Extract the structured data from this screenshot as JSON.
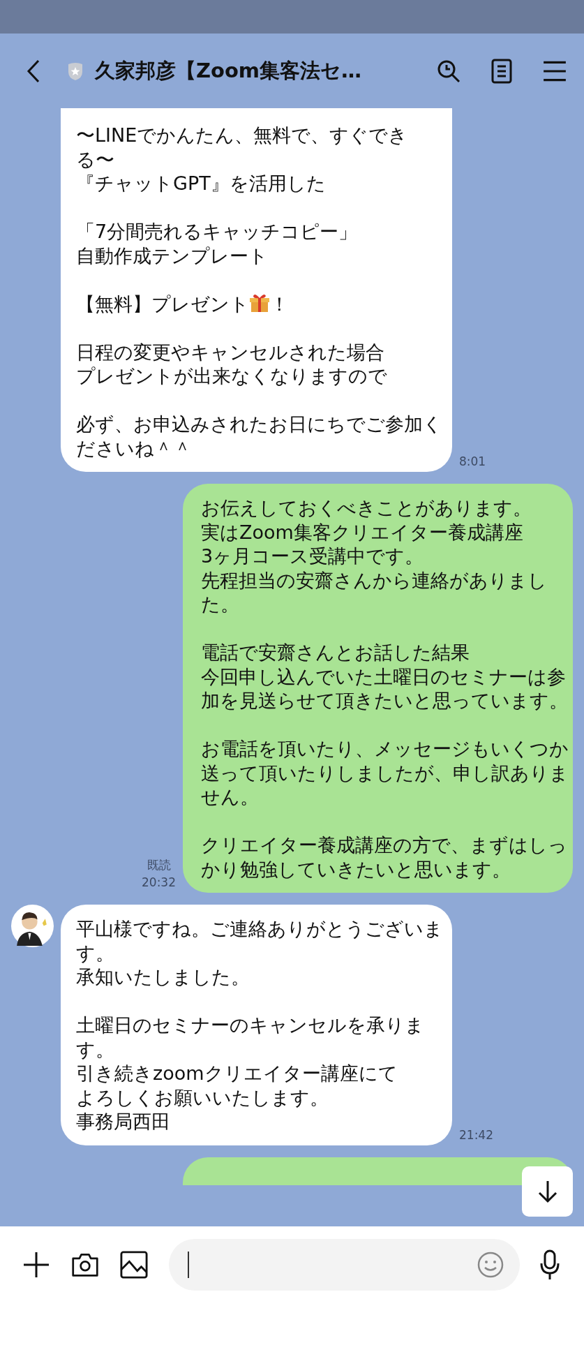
{
  "header": {
    "title": "久家邦彦【Zoom集客法セ…"
  },
  "messages": [
    {
      "kind": "incoming",
      "avatar": false,
      "cut_top": true,
      "time": "8:01",
      "paragraphs": [
        {
          "kind": "text",
          "lines": [
            "〜LINEでかんたん、無料で、すぐできる〜",
            "『チャットGPT』を活用した"
          ]
        },
        {
          "kind": "text",
          "lines": [
            "「7分間売れるキャッチコピー」",
            "自動作成テンプレート"
          ]
        },
        {
          "kind": "gift",
          "before": "【無料】プレゼント",
          "after": "！"
        },
        {
          "kind": "text",
          "lines": [
            "日程の変更やキャンセルされた場合",
            "プレゼントが出来なくなりますので"
          ]
        },
        {
          "kind": "text",
          "lines": [
            "必ず、お申込みされたお日にちでご参加くださいね＾＾"
          ]
        }
      ]
    },
    {
      "kind": "outgoing",
      "read": "既読",
      "time": "20:32",
      "paragraphs": [
        {
          "kind": "text",
          "lines": [
            "お伝えしておくべきことがあります。",
            "実はZoom集客クリエイター養成講座",
            "3ヶ月コース受講中です。",
            "先程担当の安齋さんから連絡がありました。"
          ]
        },
        {
          "kind": "text",
          "lines": [
            "電話で安齋さんとお話した結果",
            "今回申し込んでいた土曜日のセミナーは参加を見送らせて頂きたいと思っています。"
          ]
        },
        {
          "kind": "text",
          "lines": [
            "お電話を頂いたり、メッセージもいくつか送って頂いたりしましたが、申し訳ありません。"
          ]
        },
        {
          "kind": "text",
          "lines": [
            "クリエイター養成講座の方で、まずはしっかり勉強していきたいと思います。"
          ]
        }
      ]
    },
    {
      "kind": "incoming",
      "avatar": true,
      "time": "21:42",
      "paragraphs": [
        {
          "kind": "text",
          "lines": [
            "平山様ですね。ご連絡ありがとうございます。",
            "承知いたしました。"
          ]
        },
        {
          "kind": "text",
          "lines": [
            "土曜日のセミナーのキャンセルを承ります。",
            "引き続きzoomクリエイター講座にて",
            "よろしくお願いいたします。",
            "事務局西田"
          ]
        }
      ]
    },
    {
      "kind": "outgoing",
      "cut_bottom": true
    }
  ]
}
